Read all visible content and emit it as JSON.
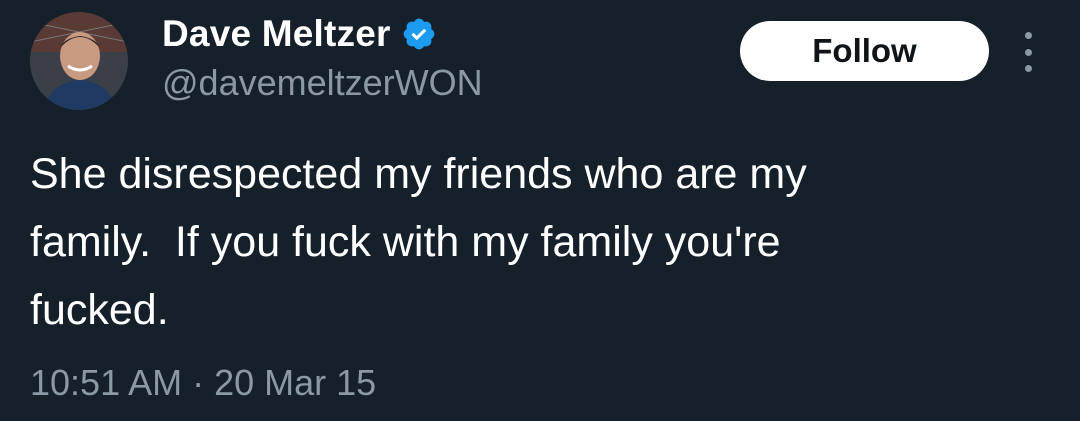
{
  "author": {
    "display_name": "Dave Meltzer",
    "handle": "@davemeltzerWON",
    "verified_icon": "verified-badge-icon",
    "verified_color": "#1d9bf0"
  },
  "actions": {
    "follow_label": "Follow",
    "more_icon": "more-vertical-icon"
  },
  "tweet": {
    "text": "She disrespected my friends who are my\nfamily.  If you fuck with my family you're\nfucked.",
    "timestamp": "10:51 AM · 20 Mar 15"
  },
  "colors": {
    "background": "#15202b",
    "primary_text": "#ffffff",
    "secondary_text": "#8b98a5",
    "button_bg": "#ffffff",
    "button_text": "#0f1419"
  }
}
